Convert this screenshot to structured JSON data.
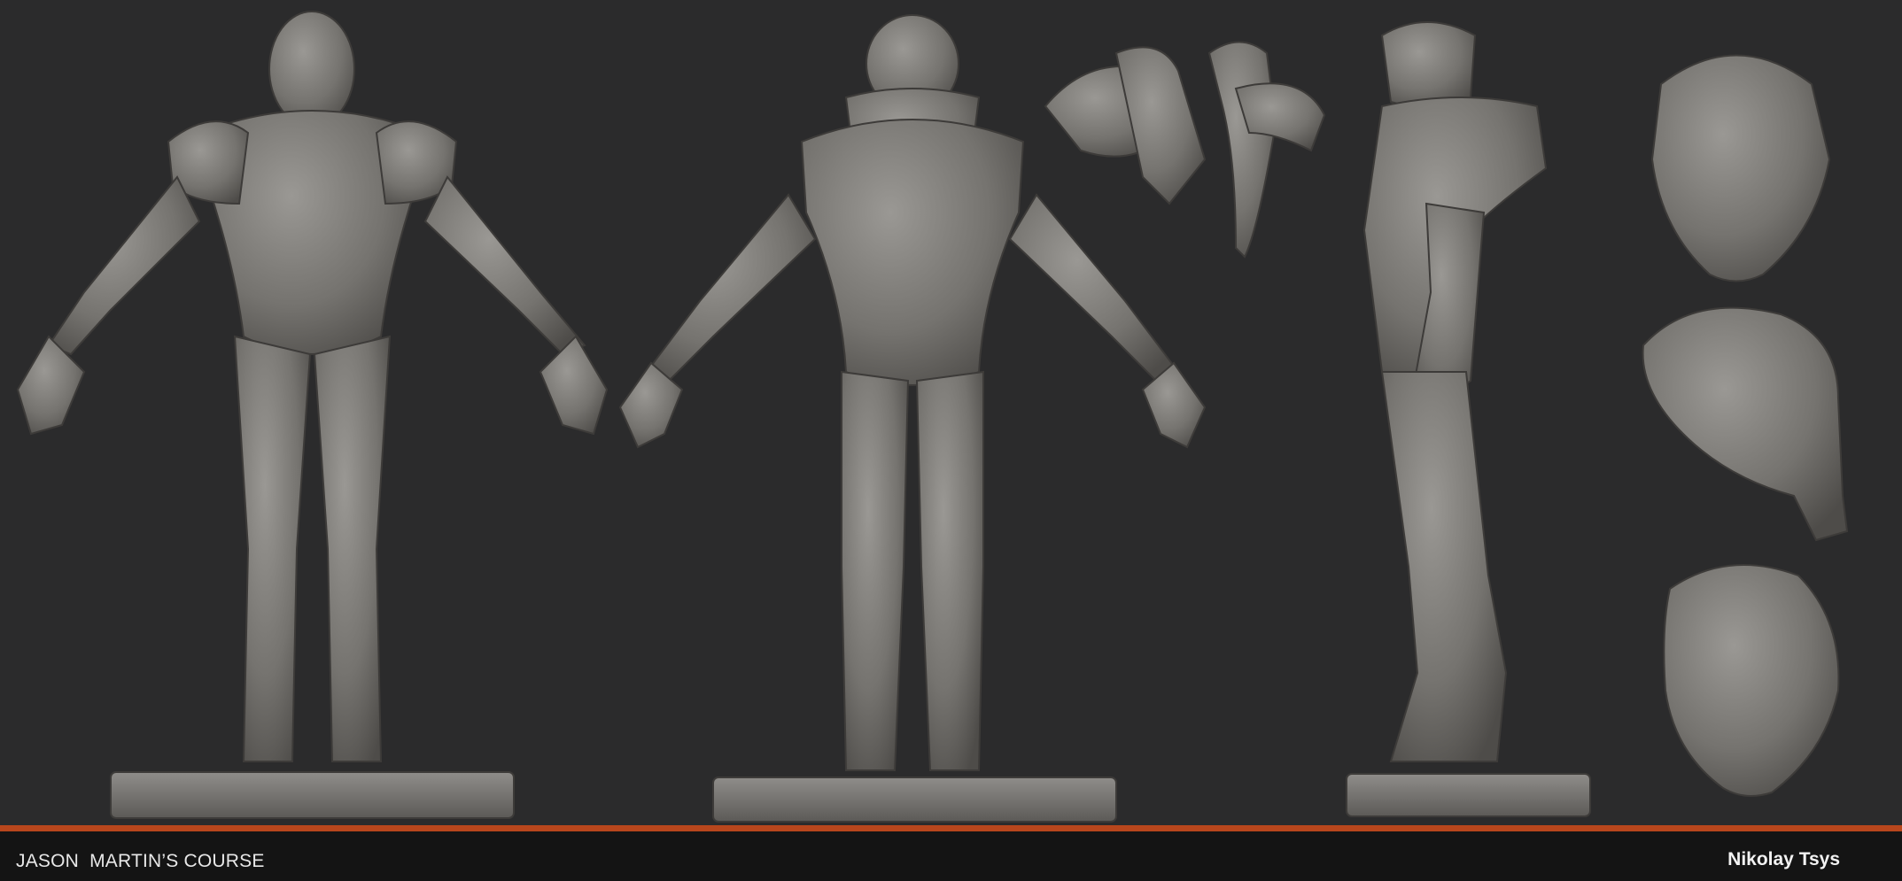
{
  "footer": {
    "course_label": "JASON  MARTIN’S COURSE",
    "author_name": "Nikolay Tsys"
  },
  "colors": {
    "background": "#2b2b2c",
    "accent_stripe": "#b8461c",
    "footer_bar": "#141414",
    "sculpt_clay": "#7d7b78"
  },
  "views": [
    "front-view",
    "back-view",
    "side-view",
    "armor-parts",
    "helmet-front",
    "helmet-side",
    "helmet-bottom"
  ]
}
